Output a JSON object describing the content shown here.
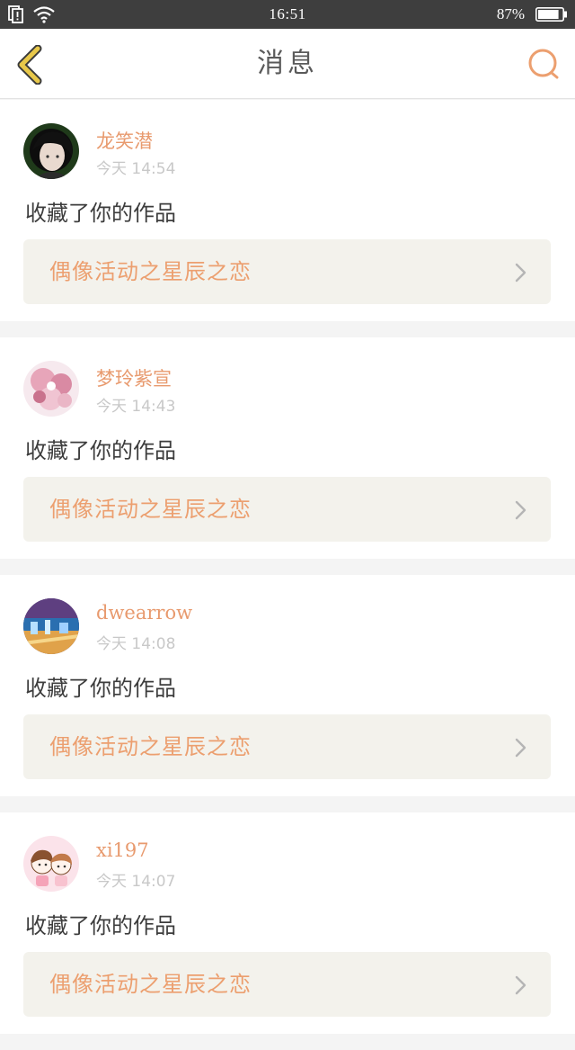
{
  "status_bar": {
    "time": "16:51",
    "battery_percent": "87%",
    "battery_level": 0.87,
    "icons": [
      "sim-alert-icon",
      "wifi-icon",
      "battery-icon"
    ]
  },
  "nav": {
    "title": "消息",
    "back_icon": "chevron-left-icon",
    "search_icon": "search-icon"
  },
  "colors": {
    "accent": "#ec9f6f",
    "back_icon": "#e8c84a",
    "status_bar_bg": "#3e3e3e",
    "link_box_bg": "#f3f2ec"
  },
  "messages": [
    {
      "username": "龙笑潜",
      "time": "今天 14:54",
      "action": "收藏了你的作品",
      "work": "偶像活动之星辰之恋"
    },
    {
      "username": "梦玲紫宣",
      "time": "今天 14:43",
      "action": "收藏了你的作品",
      "work": "偶像活动之星辰之恋"
    },
    {
      "username": "dwearrow",
      "time": "今天 14:08",
      "action": "收藏了你的作品",
      "work": "偶像活动之星辰之恋"
    },
    {
      "username": "xi197",
      "time": "今天 14:07",
      "action": "收藏了你的作品",
      "work": "偶像活动之星辰之恋"
    }
  ]
}
